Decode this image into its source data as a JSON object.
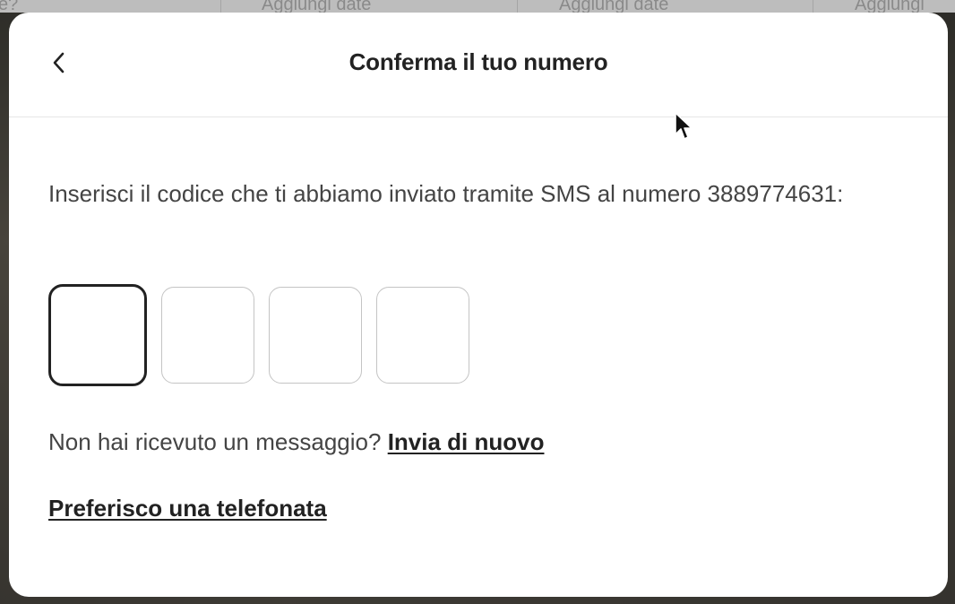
{
  "background": {
    "topbar_cells": [
      "e?",
      "Aggiungi date",
      "Aggiungi date",
      "Aggiungi"
    ]
  },
  "modal": {
    "title": "Conferma il tuo numero",
    "back_icon": "chevron-left-icon",
    "instruction": "Inserisci il codice che ti abbiamo inviato tramite SMS al numero 3889774631:",
    "code_inputs": [
      "",
      "",
      "",
      ""
    ],
    "resend_prompt": "Non hai ricevuto un messaggio?",
    "resend_link": "Invia di nuovo",
    "call_link": "Preferisco una telefonata"
  },
  "colors": {
    "text_primary": "#222222",
    "text_secondary": "#444444",
    "input_border": "#c4c4c4",
    "input_border_active": "#222222"
  }
}
